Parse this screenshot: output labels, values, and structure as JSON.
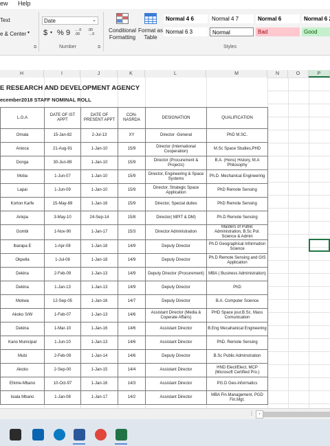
{
  "menu": {
    "view": "ew",
    "help": "Help"
  },
  "ribbon": {
    "alignment": {
      "wrap_text": "Text",
      "merge_center": "e & Center"
    },
    "number": {
      "format_value": "Date",
      "currency": "$",
      "percent": "%",
      "comma": "9",
      "inc_decimal": "←.0 .00",
      "dec_decimal": ".00 →.0",
      "group_label": "Number"
    },
    "styles": {
      "conditional_formatting": "Conditional Formatting",
      "format_as_table": "Format as Table",
      "cells": [
        {
          "label": "Normal 4 6",
          "bg": "#ffffff",
          "bold": true,
          "color": "#000000"
        },
        {
          "label": "Normal 4 7",
          "bg": "#ffffff",
          "bold": false,
          "color": "#000000"
        },
        {
          "label": "Normal 6",
          "bg": "#ffffff",
          "bold": true,
          "color": "#000000"
        },
        {
          "label": "Normal 6 2",
          "bg": "#ffffff",
          "bold": true,
          "color": "#000000"
        },
        {
          "label": "Normal 6 3",
          "bg": "#ffffff",
          "bold": false,
          "color": "#000000"
        },
        {
          "label": "Normal",
          "bg": "#ffffff",
          "bold": false,
          "color": "#000000"
        },
        {
          "label": "Bad",
          "bg": "#ffc7ce",
          "bold": false,
          "color": "#9c0006"
        },
        {
          "label": "Good",
          "bg": "#c6efce",
          "bold": false,
          "color": "#006100"
        }
      ],
      "group_label": "Styles"
    }
  },
  "columns": [
    "H",
    "I",
    "J",
    "K",
    "L",
    "M",
    "N",
    "O",
    "P"
  ],
  "sheet": {
    "title": "E RESEARCH AND DEVELOPMENT AGENCY",
    "subtitle": "ecember2018 STAFF NOMINAL ROLL",
    "headers": [
      "L.G.A",
      "DATE OF IST APPT",
      "DATE OF PRESENT APPT",
      "CON-NASRDA",
      "DESIGNATION",
      "QUALIFICATION"
    ],
    "rows": [
      [
        "Omala",
        "15-Jan-82",
        "2-Jul-13",
        "XY",
        "Director -General",
        "PhD M.SC."
      ],
      [
        "Anioca",
        "21-Aug-91",
        "1-Jan-10",
        "15/9",
        "Director (International Cooperation)",
        "M.Sc Space Studies,PHD"
      ],
      [
        "Donga",
        "30-Jun-89",
        "1-Jan-10",
        "15/9",
        "Director (Procurement & Projects)",
        "B.A. (Hons) History, M.A Philosophy"
      ],
      [
        "Moba",
        "1-Jun-07",
        "1-Jan-10",
        "15/9",
        "Director, Engineering & Space Systems",
        "Ph.D. Mechanical Engineering"
      ],
      [
        "Lapai",
        "1-Jun-09",
        "1-Jan-10",
        "15/9",
        "Director, Strategic Space Application",
        "PhD Remote Sensing"
      ],
      [
        "Korton Karfe",
        "15-May-89",
        "1-Jan-16",
        "15/9",
        "Director, Special duties",
        "PhD Remote Sensing"
      ],
      [
        "Ankpa",
        "3-May-10",
        "24-Sep-14",
        "15/8",
        "Director( MPIT & DM)",
        "Ph.D Remote Sensing"
      ],
      [
        "Gombi",
        "1-Nov-90",
        "1-Jan-17",
        "15/3",
        "Director Administration",
        "Masters of Public Administration, B.Sc Pol. Science & Admin"
      ],
      [
        "Ibarapa E",
        "1-Apr-08",
        "1-Jan-18",
        "14/9",
        "Deputy Director",
        "Ph.D Geographical Information Science"
      ],
      [
        "Okpella",
        "1-Jul-08",
        "1-Jan-18",
        "14/9",
        "Deputy Director",
        "Ph.D Remote Sensing and GIS Application"
      ],
      [
        "Dekina",
        "2-Feb-09",
        "1-Jan-13",
        "14/9",
        "Deputy Director (Procurement)",
        "MBA ( Business Administration)"
      ],
      [
        "Dekina",
        "1-Jan-13",
        "1-Jan-13",
        "14/9",
        "Deputy Director",
        "PhD"
      ],
      [
        "Mokwa",
        "12-Sep-05",
        "1-Jan-16",
        "14/7",
        "Deputy Director",
        "B.A. Computer Science"
      ],
      [
        "Akoko S/W",
        "1-Feb-07",
        "1-Jan-13",
        "14/6",
        "Assistant Director (Media & Coperate Affairs)",
        "PHD Space jour,B.Sc. Mass Comunication"
      ],
      [
        "Dekina",
        "1-Mar-10",
        "1-Jan-16",
        "14/6",
        "Assistant Director",
        "B.Eng Mecahanical Engineering"
      ],
      [
        "Kano Municipal",
        "1-Jun-10",
        "1-Jan-13",
        "14/6",
        "Assistant Director",
        "PhD. Remote Sensing"
      ],
      [
        "Mubi",
        "2-Feb-09",
        "1-Jan-14",
        "14/6",
        "Deputy Director",
        "B.Sc Public Adminstration"
      ],
      [
        "Akoko",
        "2-Sep-00",
        "1-Jan-15",
        "14/4",
        "Assistant Director",
        "HND Elect/Elect, MCP (Microsoft Certified Pro.)"
      ],
      [
        "Ehime-Mbano",
        "10-Oct-97",
        "1-Jan-16",
        "14/3",
        "Assistant Director",
        "PG.D Geo-informatics"
      ],
      [
        "Isiala Mbano",
        "1-Jan-08",
        "1-Jan-17",
        "14/2",
        "Assistant Director",
        "MBA Fin.Management, PGD Fin.Mgt."
      ]
    ]
  },
  "taskbar": {
    "icons": [
      {
        "name": "store-icon",
        "color": "#2b2b2b"
      },
      {
        "name": "mail-icon",
        "color": "#0a64b0"
      },
      {
        "name": "dell-icon",
        "color": "#0a7ac2"
      },
      {
        "name": "word-icon",
        "color": "#2b579a"
      },
      {
        "name": "chrome-icon",
        "color": "#e0463a"
      },
      {
        "name": "excel-icon",
        "color": "#217346"
      }
    ]
  }
}
